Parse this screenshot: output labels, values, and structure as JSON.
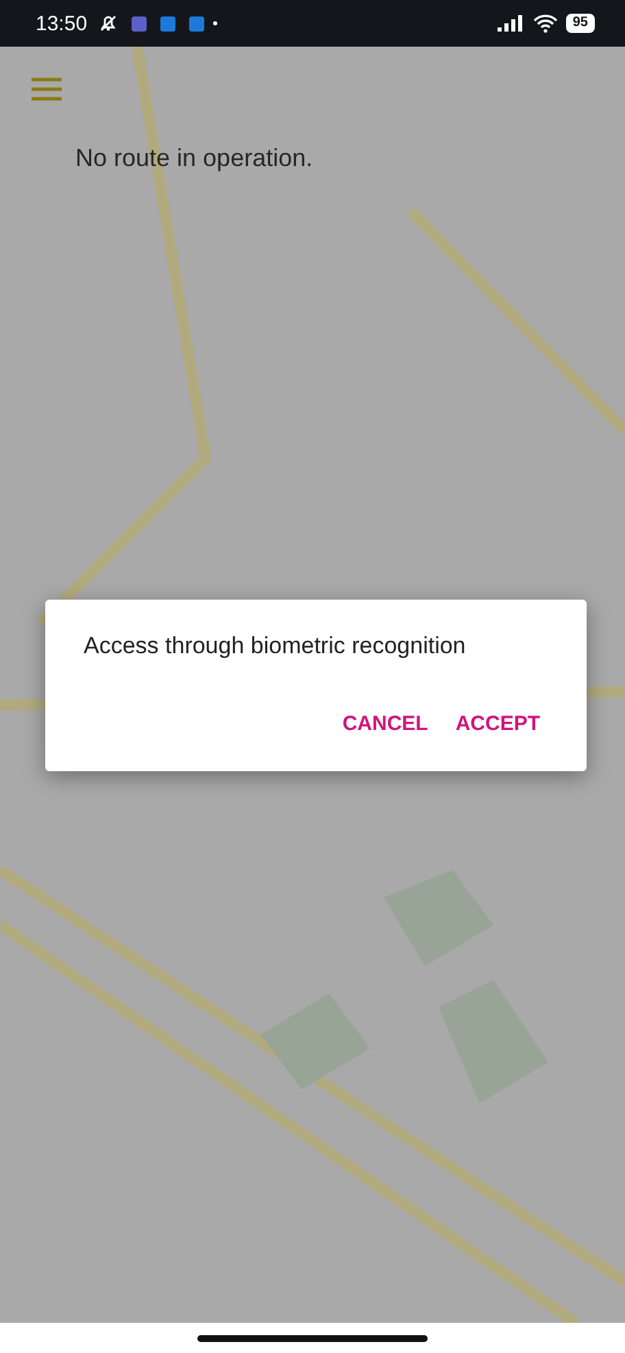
{
  "status_bar": {
    "time": "13:50",
    "battery": "95"
  },
  "notice": "No route in operation.",
  "dialog": {
    "message": "Access through biometric recognition",
    "buttons": [
      "CANCEL",
      "ACCEPT"
    ]
  }
}
